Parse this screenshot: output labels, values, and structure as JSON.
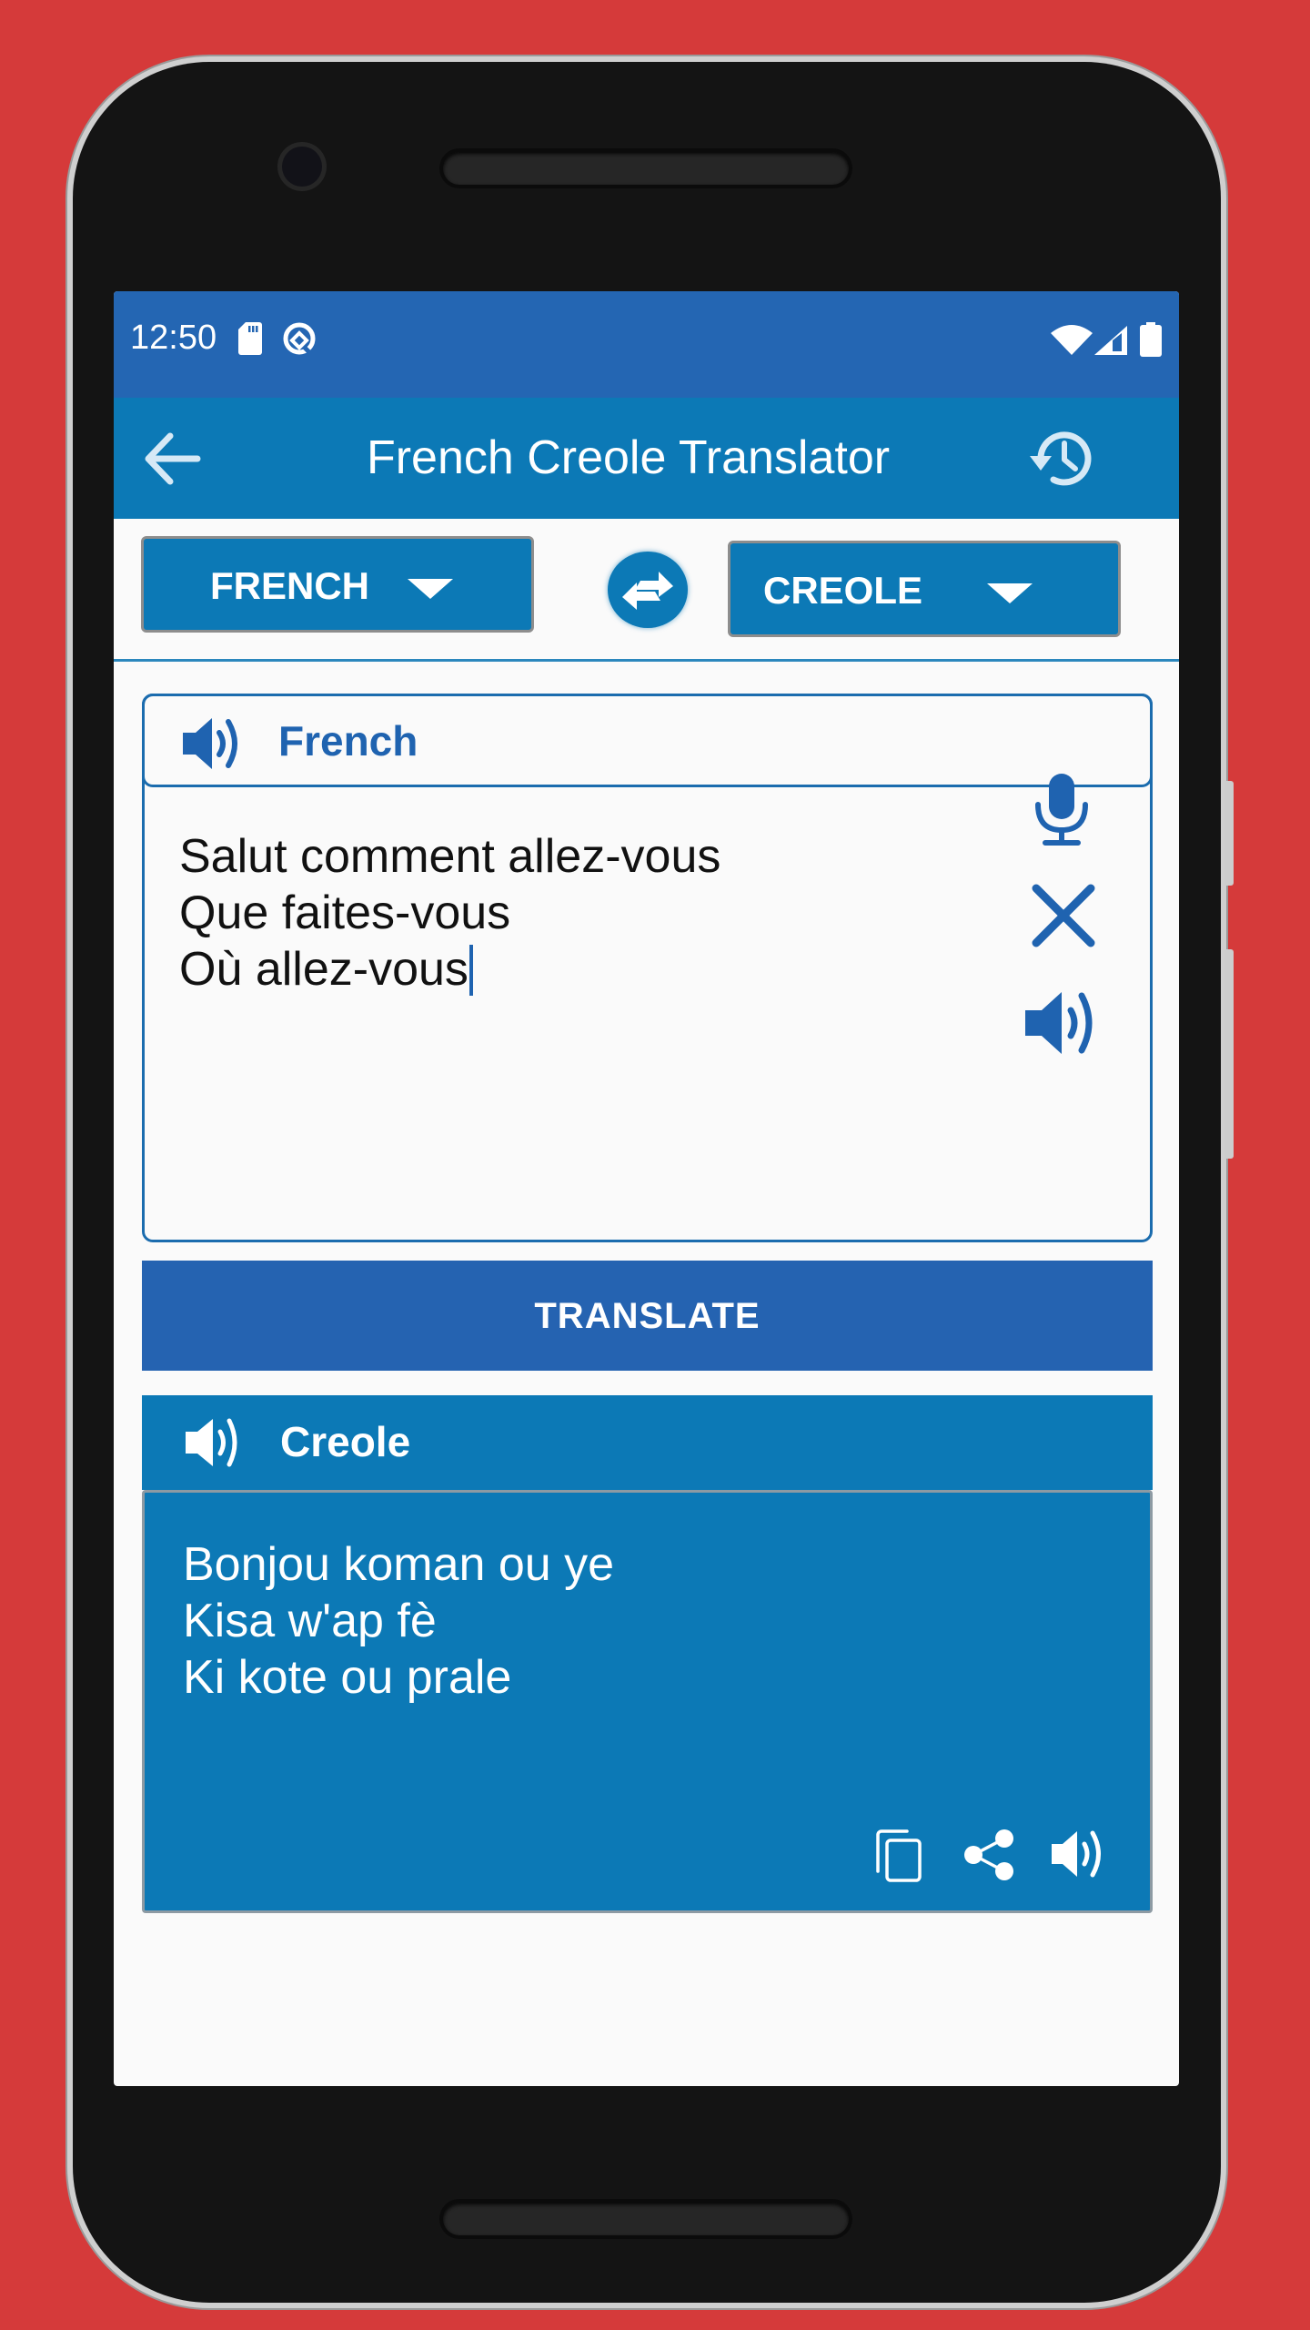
{
  "status_bar": {
    "time": "12:50",
    "left_icons": [
      "sd-card-icon",
      "data-saver-icon"
    ],
    "right_icons": [
      "wifi-icon",
      "signal-icon",
      "battery-icon"
    ]
  },
  "toolbar": {
    "title": "French Creole Translator",
    "back_icon": "arrow-left-icon",
    "history_icon": "history-icon"
  },
  "language_bar": {
    "source_language": "FRENCH",
    "target_language": "CREOLE",
    "swap_icon": "swap-arrows-icon"
  },
  "input_card": {
    "header_label": "French",
    "text_lines": [
      "Salut comment allez-vous",
      "Que faites-vous",
      "Où allez-vous"
    ],
    "actions": [
      "microphone-icon",
      "clear-icon",
      "speaker-icon"
    ]
  },
  "translate_button": {
    "label": "TRANSLATE"
  },
  "output_card": {
    "header_label": "Creole",
    "text_lines": [
      "Bonjou koman ou ye",
      "Kisa w'ap fè",
      "Ki kote ou prale"
    ],
    "actions": [
      "copy-icon",
      "share-icon",
      "speaker-icon"
    ]
  },
  "colors": {
    "background": "#d53a3a",
    "status_bar": "#2466b3",
    "toolbar": "#0c79b6",
    "accent": "#1f63b0",
    "translate_button": "#2563b1"
  }
}
